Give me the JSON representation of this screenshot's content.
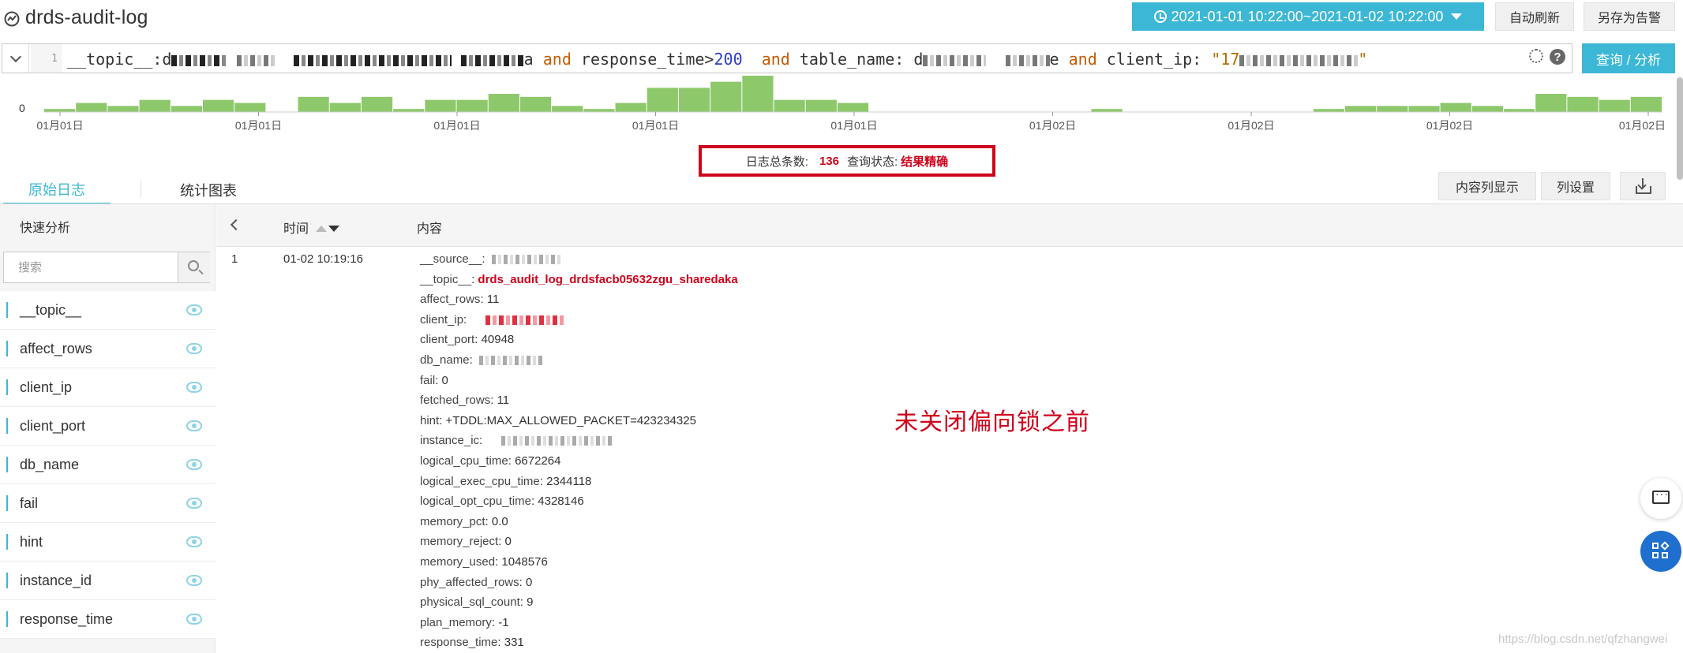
{
  "header": {
    "title": "drds-audit-log",
    "time_range": "2021-01-01 10:22:00~2021-01-02 10:22:00",
    "auto_refresh": "自动刷新",
    "save_alert": "另存为告警"
  },
  "query": {
    "line_number": "1",
    "part1": "__topic__:d",
    "part2": "a ",
    "and1": "and",
    "response_key": " response_time>",
    "response_value": "200",
    "and2": "and",
    "table_key": " table_name: ",
    "table_prefix": "d",
    "table_suffix": "e ",
    "and3": "and",
    "client_key": " client_ip: ",
    "client_value_prefix": "\"17",
    "client_value_suffix": "\"",
    "help": "?",
    "search_button": "查询 / 分析"
  },
  "histogram": {
    "y_label": "0",
    "ticks": [
      "01月01日",
      "01月01日",
      "01月01日",
      "01月01日",
      "01月01日",
      "01月02日",
      "01月02日",
      "01月02日",
      "01月02日"
    ],
    "bar_color": "#8dc86b",
    "values": [
      1,
      3,
      2,
      4,
      2,
      4,
      3,
      0,
      5,
      3,
      5,
      1,
      4,
      4,
      6,
      5,
      2,
      1,
      3,
      8,
      8,
      10,
      12,
      4,
      4,
      3,
      0,
      0,
      0,
      0,
      0,
      0,
      0,
      1,
      0,
      0,
      0,
      0,
      0,
      0,
      1,
      2,
      2,
      2,
      3,
      2,
      1,
      6,
      5,
      4,
      5
    ],
    "max": 12
  },
  "summary": {
    "total_label": "日志总条数:",
    "total_value": "136",
    "status_label": "查询状态:",
    "status_value": "结果精确"
  },
  "tabs": [
    {
      "label": "原始日志",
      "active": true
    },
    {
      "label": "统计图表",
      "active": false
    }
  ],
  "toolbar": {
    "content_display": "内容列显示",
    "column_settings": "列设置"
  },
  "sidebar": {
    "title": "快速分析",
    "search_placeholder": "搜索",
    "fields": [
      "__topic__",
      "affect_rows",
      "client_ip",
      "client_port",
      "db_name",
      "fail",
      "hint",
      "instance_id",
      "response_time"
    ]
  },
  "table": {
    "col_time": "时间",
    "col_content": "内容",
    "row": {
      "index": "1",
      "time": "01-02 10:19:16",
      "entries": [
        {
          "key": "__source__",
          "value": ""
        },
        {
          "key": "__topic__",
          "value": "drds_audit_log_drdsfacb05632zgu_sharedaka"
        },
        {
          "key": "affect_rows",
          "value": "11"
        },
        {
          "key": "client_ip",
          "value": ""
        },
        {
          "key": "client_port",
          "value": "40948"
        },
        {
          "key": "db_name",
          "value": ""
        },
        {
          "key": "fail",
          "value": "0"
        },
        {
          "key": "fetched_rows",
          "value": "11"
        },
        {
          "key": "hint",
          "value": "+TDDL:MAX_ALLOWED_PACKET=423234325"
        },
        {
          "key": "instance_ic",
          "value": ""
        },
        {
          "key": "logical_cpu_time",
          "value": "6672264"
        },
        {
          "key": "logical_exec_cpu_time",
          "value": "2344118"
        },
        {
          "key": "logical_opt_cpu_time",
          "value": "4328146"
        },
        {
          "key": "memory_pct",
          "value": "0.0"
        },
        {
          "key": "memory_reject",
          "value": "0"
        },
        {
          "key": "memory_used",
          "value": "1048576"
        },
        {
          "key": "phy_affected_rows",
          "value": "0"
        },
        {
          "key": "physical_sql_count",
          "value": "9"
        },
        {
          "key": "plan_memory",
          "value": "-1"
        },
        {
          "key": "response_time",
          "value": "331"
        }
      ]
    }
  },
  "annotation": "未关闭偏向锁之前",
  "watermark": "https://blog.csdn.net/qfzhangwei"
}
